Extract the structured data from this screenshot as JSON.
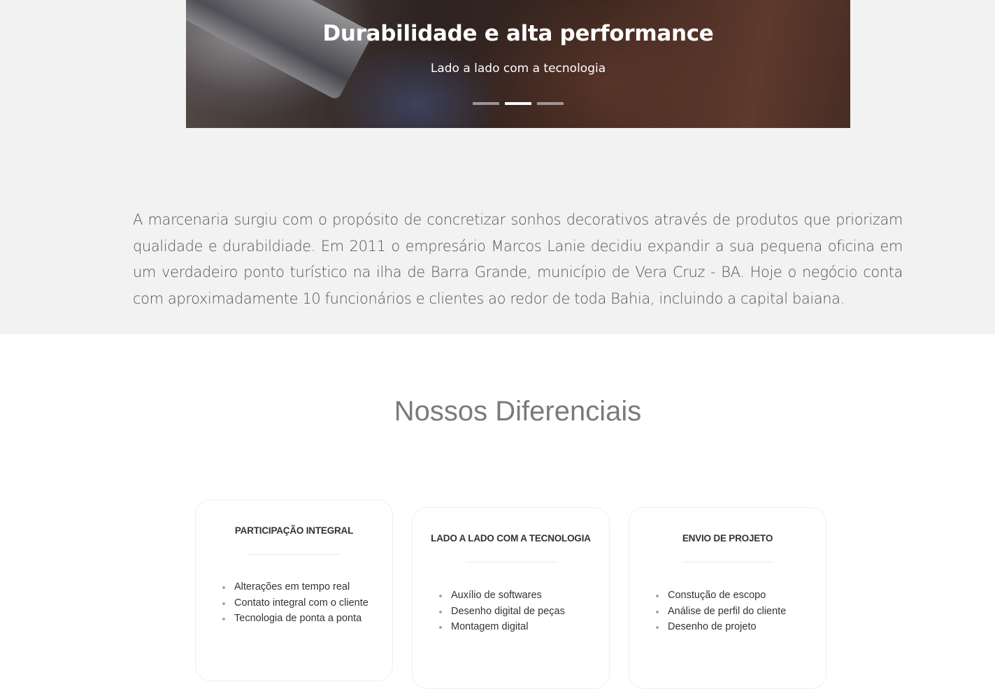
{
  "carousel": {
    "title": "Durabilidade e alta performance",
    "subtitle": "Lado a lado com a tecnologia",
    "slide_count": 3,
    "active_slide": 2
  },
  "about": {
    "text": "A marcenaria surgiu com o propósito de concretizar sonhos decorativos através de produtos que priorizam qualidade e durabildiade. Em 2011 o empresário Marcos Lanie decidiu expandir a sua pequena oficina em um verdadeiro ponto turístico na ilha de Barra Grande, município de Vera Cruz - BA. Hoje o negócio conta com aproximadamente 10 funcionários e clientes ao redor de toda Bahia, incluindo a capital baiana."
  },
  "differentials": {
    "title": "Nossos Diferenciais",
    "cards": [
      {
        "title": "PARTICIPAÇÃO INTEGRAL",
        "items": [
          "Alterações em tempo real",
          "Contato integral com o cliente",
          "Tecnologia de ponta a ponta"
        ]
      },
      {
        "title": "LADO A LADO COM A TECNOLOGIA",
        "items": [
          "Auxílio de softwares",
          "Desenho digital de peças",
          "Montagem digital"
        ]
      },
      {
        "title": "ENVIO DE PROJETO",
        "items": [
          "Constução de escopo",
          "Análise de perfil do cliente",
          "Desenho de projeto"
        ]
      }
    ]
  },
  "colors": {
    "band_background": "#f2f2f2",
    "bullet": "#c29a9a",
    "section_title": "#7a7a7a"
  }
}
